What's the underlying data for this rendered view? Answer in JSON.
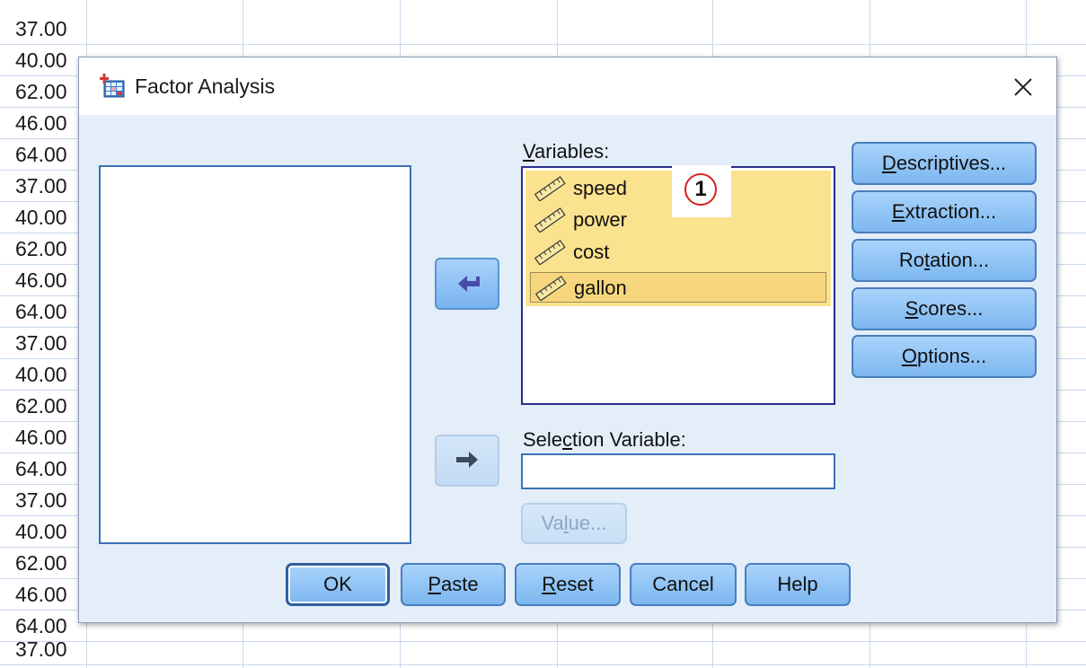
{
  "sheet": {
    "values": [
      "37.00",
      "40.00",
      "62.00",
      "46.00",
      "64.00",
      "37.00",
      "40.00",
      "62.00",
      "46.00",
      "64.00",
      "37.00",
      "40.00",
      "62.00",
      "46.00",
      "64.00",
      "37.00"
    ]
  },
  "dialog": {
    "title": "Factor Analysis",
    "close_icon": "close-x-icon",
    "variables_label": {
      "mnemonic": "V",
      "rest": "ariables:"
    },
    "variables": [
      {
        "name": "speed",
        "icon": "scale-ruler-icon"
      },
      {
        "name": "power",
        "icon": "scale-ruler-icon"
      },
      {
        "name": "cost",
        "icon": "scale-ruler-icon"
      },
      {
        "name": "gallon",
        "icon": "scale-ruler-icon",
        "selected": true
      }
    ],
    "annotation_badge": "1",
    "selection_label": {
      "pre": "Sele",
      "mnemonic": "c",
      "post": "tion Variable:"
    },
    "selection_value": "",
    "value_button": {
      "pre": "Va",
      "mnemonic": "l",
      "post": "ue..."
    },
    "side_buttons": {
      "descriptives": {
        "pre": "",
        "mnemonic": "D",
        "post": "escriptives..."
      },
      "extraction": {
        "pre": "",
        "mnemonic": "E",
        "post": "xtraction..."
      },
      "rotation": {
        "pre": "Ro",
        "mnemonic": "t",
        "post": "ation..."
      },
      "scores": {
        "pre": "",
        "mnemonic": "S",
        "post": "cores..."
      },
      "options": {
        "pre": "",
        "mnemonic": "O",
        "post": "ptions..."
      }
    },
    "bottom_buttons": {
      "ok": "OK",
      "paste": {
        "mnemonic": "P",
        "post": "aste"
      },
      "reset": {
        "mnemonic": "R",
        "post": "eset"
      },
      "cancel": "Cancel",
      "help": "Help"
    },
    "colors": {
      "accent": "#7db7f0",
      "selected_vars": "#fbe28f",
      "badge_ring": "#d62020"
    }
  }
}
